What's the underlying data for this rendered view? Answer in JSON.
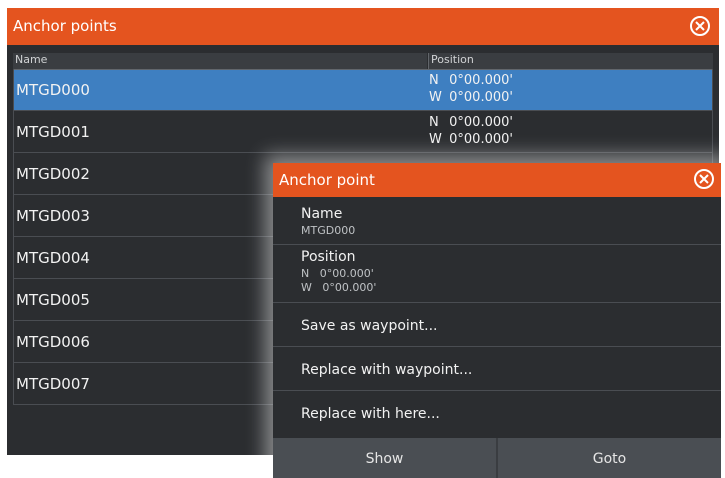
{
  "list_window": {
    "title": "Anchor points",
    "columns": {
      "name": "Name",
      "position": "Position"
    },
    "rows": [
      {
        "name": "MTGD000",
        "lat_hem": "N",
        "lat": "0°00.000'",
        "lon_hem": "W",
        "lon": "0°00.000'",
        "selected": true
      },
      {
        "name": "MTGD001",
        "lat_hem": "N",
        "lat": "0°00.000'",
        "lon_hem": "W",
        "lon": "0°00.000'"
      },
      {
        "name": "MTGD002"
      },
      {
        "name": "MTGD003"
      },
      {
        "name": "MTGD004"
      },
      {
        "name": "MTGD005"
      },
      {
        "name": "MTGD006"
      },
      {
        "name": "MTGD007"
      }
    ]
  },
  "dialog": {
    "title": "Anchor point",
    "name_label": "Name",
    "name_value": "MTGD000",
    "position_label": "Position",
    "lat_line": "N   0°00.000'",
    "lon_line": "W   0°00.000'",
    "options": [
      "Save as waypoint...",
      "Replace with waypoint...",
      "Replace with here..."
    ],
    "buttons": {
      "show": "Show",
      "goto": "Goto"
    }
  },
  "colors": {
    "accent": "#e4541f",
    "selection": "#3e7fc1",
    "background": "#2b2d30"
  },
  "icons": {
    "close": "close-circle-icon"
  }
}
